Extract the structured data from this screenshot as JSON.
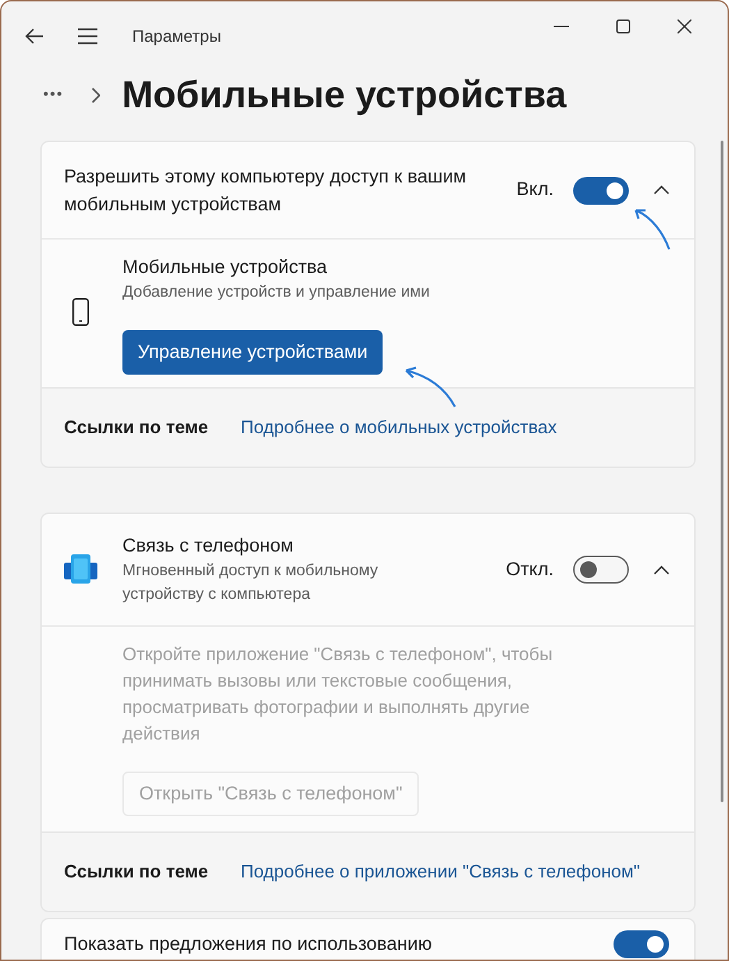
{
  "window": {
    "title": "Параметры"
  },
  "breadcrumb": {
    "overflow": "•••",
    "title": "Мобильные устройства"
  },
  "cards": [
    {
      "header": {
        "kind": "plain",
        "title": "Разрешить этому компьютеру доступ к вашим мобильным устройствам",
        "toggle": {
          "label": "Вкл.",
          "on": true
        }
      },
      "expanded": true,
      "content": {
        "kind": "device",
        "title": "Мобильные устройства",
        "subtitle": "Добавление устройств и управление ими",
        "button": {
          "label": "Управление устройствами",
          "disabled": false
        }
      },
      "related": {
        "label": "Ссылки по теме",
        "link": "Подробнее о мобильных устройствах"
      }
    },
    {
      "header": {
        "kind": "app",
        "title": "Связь с телефоном",
        "subtitle": "Мгновенный доступ к мобильному устройству с компьютера",
        "toggle": {
          "label": "Откл.",
          "on": false
        }
      },
      "expanded": true,
      "content": {
        "kind": "text",
        "text": "Откройте приложение \"Связь с телефоном\", чтобы принимать вызовы или текстовые сообщения, просматривать фотографии и выполнять другие действия",
        "button": {
          "label": "Открыть \"Связь с телефоном\"",
          "disabled": true
        }
      },
      "related": {
        "label": "Ссылки по теме",
        "link": "Подробнее о приложении \"Связь с телефоном\""
      }
    },
    {
      "header": {
        "kind": "plain",
        "title": "Показать предложения по использованию",
        "toggle": {
          "on": true
        }
      },
      "expanded": false
    }
  ]
}
